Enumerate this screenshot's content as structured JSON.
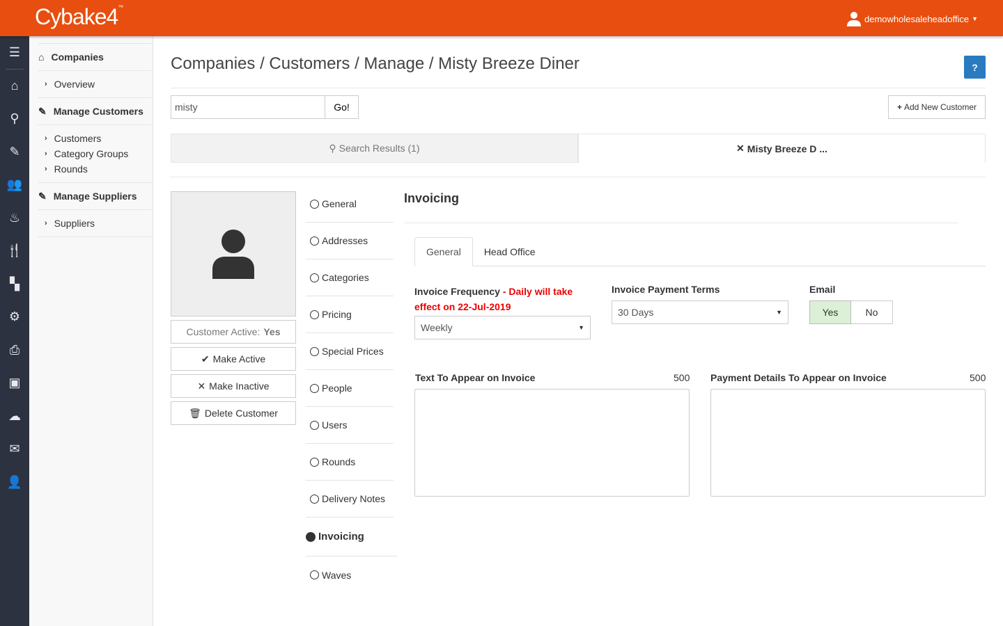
{
  "header": {
    "logo": "Cybake4",
    "username": "demowholesaleheadoffice",
    "brand_color": "#e84e0f"
  },
  "rail": {
    "icons": [
      "menu-icon",
      "home-icon",
      "search-icon",
      "edit-icon",
      "users-icon",
      "cake-icon",
      "utensils-icon",
      "sitemap-icon",
      "cogs-icon",
      "print-icon",
      "money-icon",
      "cloud-download-icon",
      "envelope-icon",
      "user-lock-icon"
    ]
  },
  "sidebar": {
    "companies": "Companies",
    "overview": "Overview",
    "manage_customers": "Manage Customers",
    "customers": "Customers",
    "category_groups": "Category Groups",
    "rounds": "Rounds",
    "manage_suppliers": "Manage Suppliers",
    "suppliers": "Suppliers"
  },
  "breadcrumb": "Companies / Customers / Manage / Misty Breeze Diner",
  "help_label": "?",
  "search": {
    "value": "misty",
    "go": "Go!"
  },
  "add_customer": "Add New Customer",
  "tabs": {
    "results": "Search Results (1)",
    "current": "Misty Breeze D ..."
  },
  "customer": {
    "active_label": "Customer Active:",
    "active_value": "Yes",
    "make_active": "Make Active",
    "make_inactive": "Make Inactive",
    "delete": "Delete Customer"
  },
  "nav": [
    "General",
    "Addresses",
    "Categories",
    "Pricing",
    "Special Prices",
    "People",
    "Users",
    "Rounds",
    "Delivery Notes",
    "Invoicing",
    "Waves"
  ],
  "nav_active": "Invoicing",
  "panel": {
    "title": "Invoicing",
    "tabs": [
      "General",
      "Head Office"
    ],
    "freq_label": "Invoice Frequency",
    "freq_note": "- Daily will take effect on 22-Jul-2019",
    "freq_value": "Weekly",
    "terms_label": "Invoice Payment Terms",
    "terms_value": "30 Days",
    "email_label": "Email",
    "email_yes": "Yes",
    "email_no": "No",
    "email_selected": "Yes",
    "text_label": "Text To Appear on Invoice",
    "text_count": "500",
    "pay_label": "Payment Details To Appear on Invoice",
    "pay_count": "500"
  }
}
